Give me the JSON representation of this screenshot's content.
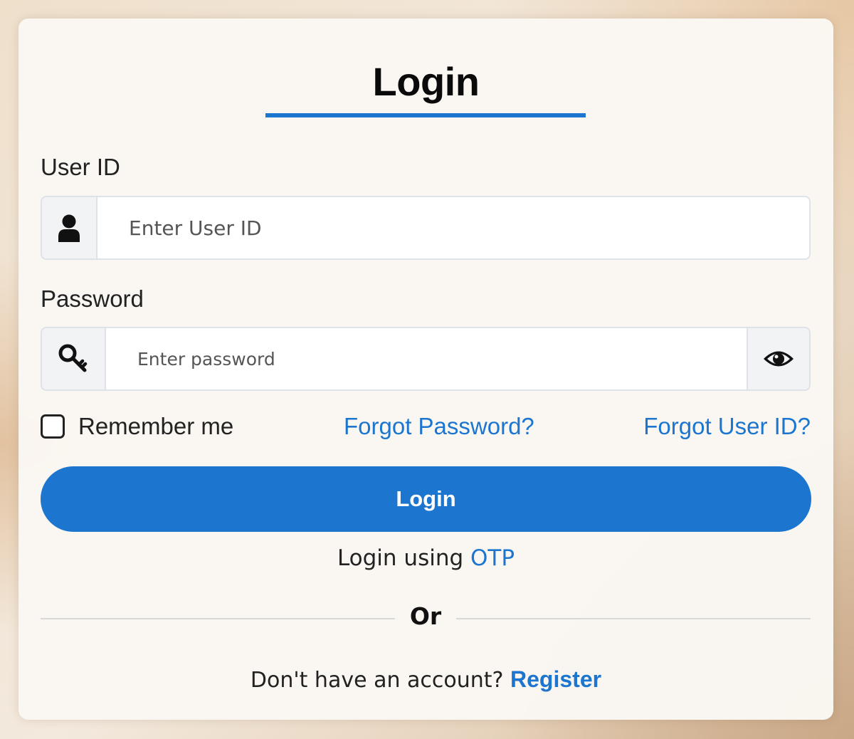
{
  "form": {
    "title": "Login",
    "user_id": {
      "label": "User ID",
      "placeholder": "Enter User ID",
      "icon": "user-icon"
    },
    "password": {
      "label": "Password",
      "placeholder": "Enter password",
      "icon": "key-icon",
      "toggle_icon": "eye-icon"
    },
    "remember_label": "Remember me",
    "forgot_password": "Forgot Password?",
    "forgot_user_id": "Forgot User ID?",
    "login_button": "Login",
    "otp_prefix": "Login using",
    "otp_link": "OTP",
    "divider_text": "Or",
    "register_prefix": "Don't have an account?",
    "register_link": "Register"
  },
  "colors": {
    "accent": "#1c76cf",
    "text": "#222222",
    "card_bg": "#faf7f3",
    "addon_bg": "#f2f3f5"
  }
}
